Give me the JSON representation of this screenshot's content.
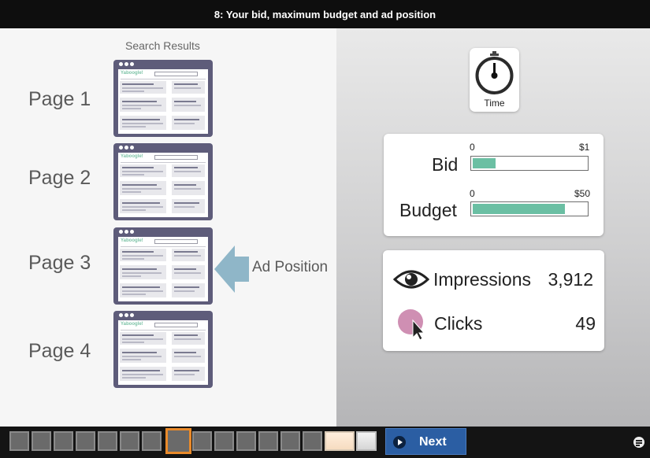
{
  "header": {
    "title": "8: Your bid, maximum budget and ad position"
  },
  "search_results": {
    "label": "Search Results",
    "brand": "Yaboogle!",
    "pages": [
      {
        "label": "Page 1"
      },
      {
        "label": "Page 2"
      },
      {
        "label": "Page 3"
      },
      {
        "label": "Page 4"
      }
    ],
    "ad_position_label": "Ad Position",
    "ad_position_page": 3
  },
  "timer": {
    "label": "Time",
    "icon": "stopwatch-icon"
  },
  "bid": {
    "label": "Bid",
    "min_label": "0",
    "max_label": "$1",
    "level": 0.2
  },
  "budget": {
    "label": "Budget",
    "min_label": "0",
    "max_label": "$50",
    "level": 0.81
  },
  "stats": {
    "impressions": {
      "label": "Impressions",
      "value": "3,912",
      "icon": "eye-icon"
    },
    "clicks": {
      "label": "Clicks",
      "value": "49",
      "icon": "click-cursor-icon"
    }
  },
  "colors": {
    "accent": "#6bbfa3",
    "next_button": "#2b5ea3",
    "current_slide": "#e98a2a",
    "click_circle": "#cf8fb3",
    "arrow": "#8fb6c8"
  },
  "navigation": {
    "next_label": "Next",
    "current_slide": 8,
    "slides": [
      {
        "state": "visited"
      },
      {
        "state": "visited"
      },
      {
        "state": "visited"
      },
      {
        "state": "visited"
      },
      {
        "state": "visited"
      },
      {
        "state": "visited"
      },
      {
        "state": "visited"
      },
      {
        "state": "current"
      },
      {
        "state": "visited"
      },
      {
        "state": "visited"
      },
      {
        "state": "visited"
      },
      {
        "state": "visited"
      },
      {
        "state": "visited"
      },
      {
        "state": "visited"
      },
      {
        "state": "warm"
      },
      {
        "state": "light"
      }
    ]
  }
}
